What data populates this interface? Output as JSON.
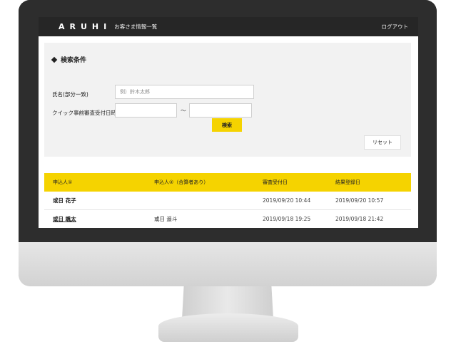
{
  "header": {
    "logo_text": "ARUHI",
    "page_title": "お客さま情報一覧",
    "logout_label": "ログアウト"
  },
  "search": {
    "section_title": "検索条件",
    "name_label": "氏名(部分一致)",
    "name_placeholder": "例）鈴木太郎",
    "date_label": "クイック事前審査受付日時",
    "date_separator": "〜",
    "search_label": "検索",
    "reset_label": "リセット"
  },
  "table": {
    "headers": [
      "申込人①",
      "申込人②（合算者あり）",
      "審査受付日",
      "結果登録日"
    ],
    "rows": [
      {
        "applicant1": "或日 花子",
        "applicant2": "",
        "received": "2019/09/20 10:44",
        "result": "2019/09/20 10:57"
      },
      {
        "applicant1": "或日 颯太",
        "applicant2": "或日 遥斗",
        "received": "2019/09/18 19:25",
        "result": "2019/09/18 21:42"
      }
    ]
  },
  "colors": {
    "accent": "#f5d300",
    "header_bg": "#262626",
    "panel_bg": "#f2f2f2"
  }
}
